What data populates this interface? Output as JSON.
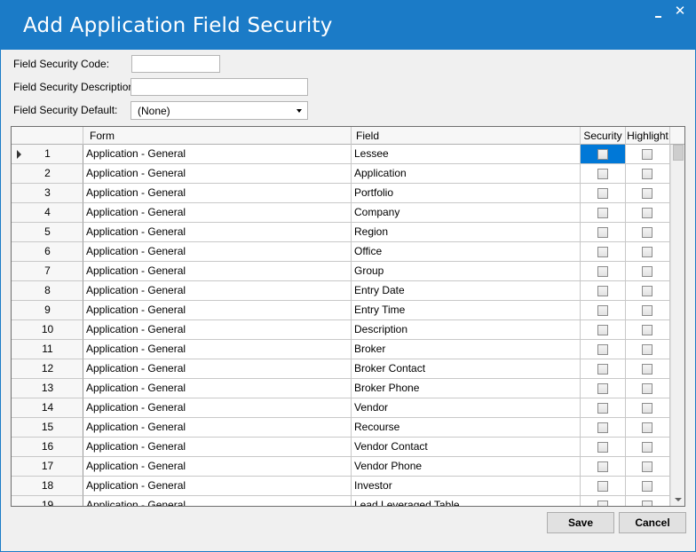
{
  "window": {
    "title": "Add Application Field Security",
    "minimize_glyph": "",
    "close_glyph": "✕"
  },
  "form": {
    "code_label": "Field Security Code:",
    "code_value": "",
    "description_label": "Field Security Description:",
    "description_value": "",
    "default_label": "Field Security Default:",
    "default_value": "(None)"
  },
  "grid": {
    "columns": {
      "form": "Form",
      "field": "Field",
      "security": "Security",
      "highlight": "Highlight"
    },
    "rows": [
      {
        "num": "1",
        "form": "Application - General",
        "field": "Lessee",
        "security": false,
        "highlight": false
      },
      {
        "num": "2",
        "form": "Application - General",
        "field": "Application",
        "security": false,
        "highlight": false
      },
      {
        "num": "3",
        "form": "Application - General",
        "field": "Portfolio",
        "security": false,
        "highlight": false
      },
      {
        "num": "4",
        "form": "Application - General",
        "field": "Company",
        "security": false,
        "highlight": false
      },
      {
        "num": "5",
        "form": "Application - General",
        "field": "Region",
        "security": false,
        "highlight": false
      },
      {
        "num": "6",
        "form": "Application - General",
        "field": "Office",
        "security": false,
        "highlight": false
      },
      {
        "num": "7",
        "form": "Application - General",
        "field": "Group",
        "security": false,
        "highlight": false
      },
      {
        "num": "8",
        "form": "Application - General",
        "field": "Entry Date",
        "security": false,
        "highlight": false
      },
      {
        "num": "9",
        "form": "Application - General",
        "field": "Entry Time",
        "security": false,
        "highlight": false
      },
      {
        "num": "10",
        "form": "Application - General",
        "field": "Description",
        "security": false,
        "highlight": false
      },
      {
        "num": "11",
        "form": "Application - General",
        "field": "Broker",
        "security": false,
        "highlight": false
      },
      {
        "num": "12",
        "form": "Application - General",
        "field": "Broker Contact",
        "security": false,
        "highlight": false
      },
      {
        "num": "13",
        "form": "Application - General",
        "field": "Broker Phone",
        "security": false,
        "highlight": false
      },
      {
        "num": "14",
        "form": "Application - General",
        "field": "Vendor",
        "security": false,
        "highlight": false
      },
      {
        "num": "15",
        "form": "Application - General",
        "field": "Recourse",
        "security": false,
        "highlight": false
      },
      {
        "num": "16",
        "form": "Application - General",
        "field": "Vendor Contact",
        "security": false,
        "highlight": false
      },
      {
        "num": "17",
        "form": "Application - General",
        "field": "Vendor Phone",
        "security": false,
        "highlight": false
      },
      {
        "num": "18",
        "form": "Application - General",
        "field": "Investor",
        "security": false,
        "highlight": false
      },
      {
        "num": "19",
        "form": "Application - General",
        "field": "Lead Leveraged Table",
        "security": false,
        "highlight": false
      }
    ],
    "selected_row": 1
  },
  "buttons": {
    "save": "Save",
    "cancel": "Cancel"
  },
  "colors": {
    "titlebar": "#1b7bc7",
    "selection": "#0078d7"
  }
}
